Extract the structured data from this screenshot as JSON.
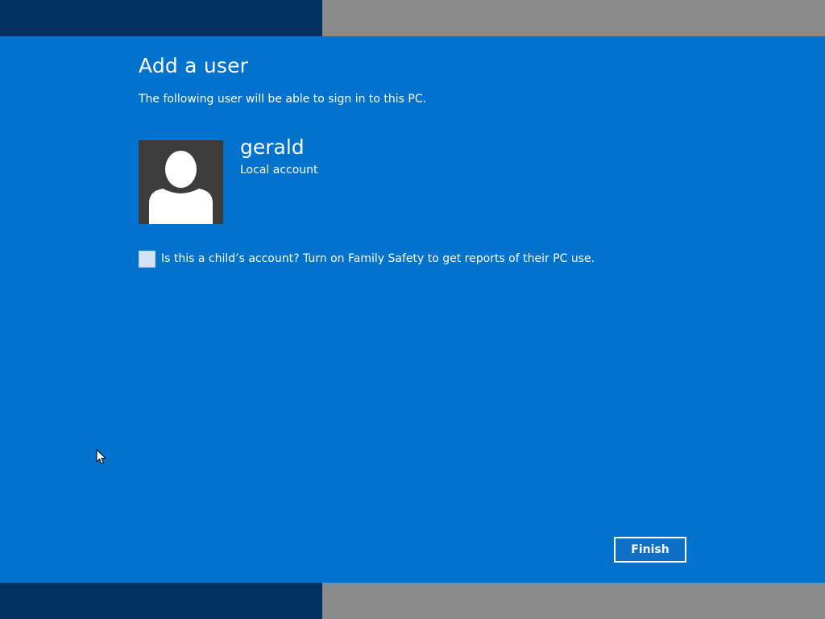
{
  "colors": {
    "dialog_background": "#0173cf",
    "band_dark": "#00305e",
    "band_gray": "#8a8a8a",
    "avatar_background": "#3c3c3c",
    "avatar_figure": "#ffffff",
    "text": "#ffffff",
    "checkbox_fill": "#d3e3f4",
    "button_fill": "#0e6fc7"
  },
  "dialog": {
    "title": "Add a user",
    "subtitle": "The following user will be able to sign in to this PC."
  },
  "user": {
    "avatar_icon": "user-silhouette-icon",
    "name": "gerald",
    "account_type": "Local account"
  },
  "child_account": {
    "checked": false,
    "label": "Is this a child’s account? Turn on Family Safety to get reports of their PC use."
  },
  "actions": {
    "finish_label": "Finish"
  },
  "pointer": {
    "icon": "mouse-cursor-icon"
  }
}
